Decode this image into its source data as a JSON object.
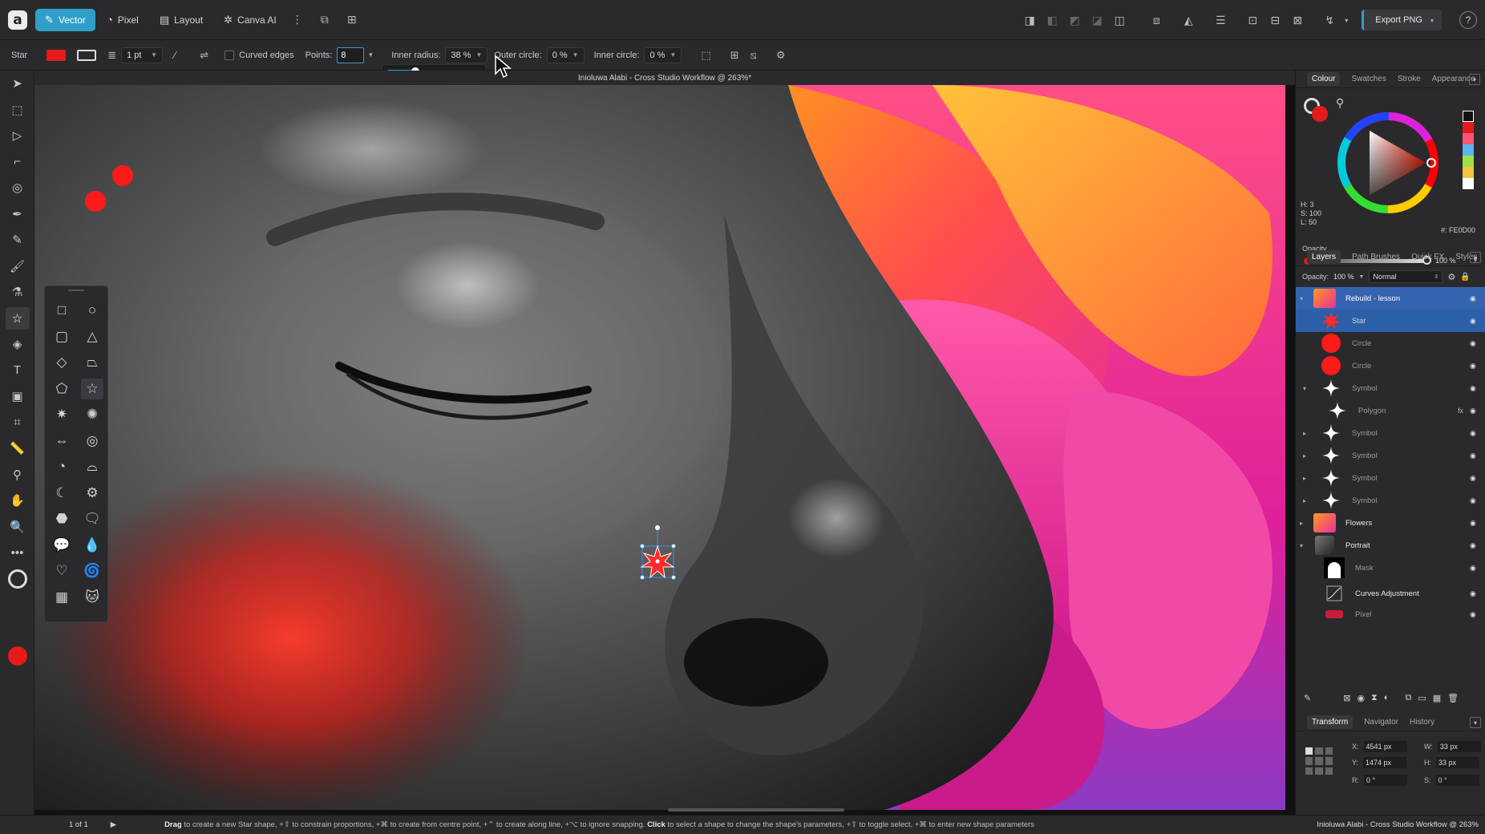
{
  "topbar": {
    "personas": [
      {
        "label": "Vector",
        "icon": "vector-icon"
      },
      {
        "label": "Pixel",
        "icon": "pixel-icon"
      },
      {
        "label": "Layout",
        "icon": "layout-icon"
      },
      {
        "label": "Canva AI",
        "icon": "sparkle-icon"
      }
    ],
    "export_label": "Export PNG"
  },
  "context_bar": {
    "tool_name": "Star",
    "stroke_width": "1 pt",
    "curved_edges_label": "Curved edges",
    "points_label": "Points:",
    "points_value": "8",
    "inner_radius_label": "Inner radius:",
    "inner_radius_value": "38 %",
    "outer_circle_label": "Outer circle:",
    "outer_circle_value": "0 %",
    "inner_circle_label": "Inner circle:",
    "inner_circle_value": "0 %",
    "slider_level": 0.38
  },
  "document": {
    "title": "Inioluwa Alabi - Cross Studio Workflow @ 263%*"
  },
  "colour_panel": {
    "tabs": [
      "Colour",
      "Swatches",
      "Stroke",
      "Appearance"
    ],
    "h": "H: 3",
    "s": "S: 100",
    "l": "L: 50",
    "hex": "#: FE0D00",
    "opacity_label": "Opacity",
    "opacity_value": "100 %",
    "accent": "#e31b1b"
  },
  "layers_panel": {
    "tabs": [
      "Layers",
      "Path Brushes",
      "Quick FX",
      "Styles"
    ],
    "opacity_label": "Opacity:",
    "opacity_value": "100 %",
    "blend_mode": "Normal",
    "layers": [
      {
        "name": "Rebuild - lesson",
        "thumb": "flowers-thumb",
        "selected": "top"
      },
      {
        "name": "Star",
        "thumb": "star-thumb",
        "selected": "yes"
      },
      {
        "name": "Circle",
        "thumb": "circle-thumb"
      },
      {
        "name": "Circle",
        "thumb": "circle-thumb"
      },
      {
        "name": "Symbol",
        "thumb": "sparkle-thumb"
      },
      {
        "name": "Polygon",
        "thumb": "sparkle-thumb",
        "fx": "fx"
      },
      {
        "name": "Symbol",
        "thumb": "sparkle-thumb"
      },
      {
        "name": "Symbol",
        "thumb": "sparkle-thumb"
      },
      {
        "name": "Symbol",
        "thumb": "sparkle-thumb"
      },
      {
        "name": "Symbol",
        "thumb": "sparkle-thumb"
      },
      {
        "name": "Flowers",
        "thumb": "flowers-thumb"
      },
      {
        "name": "Portrait",
        "thumb": "portrait-thumb"
      },
      {
        "name": "Mask",
        "thumb": "mask-thumb"
      },
      {
        "name": "Curves Adjustment",
        "thumb": "curves-thumb"
      },
      {
        "name": "Pixel",
        "thumb": "pixel-thumb"
      }
    ]
  },
  "transform_panel": {
    "tabs": [
      "Transform",
      "Navigator",
      "History"
    ],
    "x_label": "X:",
    "x_value": "4541 px",
    "y_label": "Y:",
    "y_value": "1474 px",
    "w_label": "W:",
    "w_value": "33 px",
    "h_label": "H:",
    "h_value": "33 px",
    "r_label": "R:",
    "r_value": "0 °",
    "s_label": "S:",
    "s_value": "0 °"
  },
  "statusbar": {
    "page": "1 of 1",
    "hint_drag": "Drag",
    "hint_part1": " to create a new Star shape, +⇧ to constrain proportions, +⌘ to create from centre point, +⌃ to create along line, +⌥ to ignore snapping. ",
    "hint_click": "Click",
    "hint_part2": " to select a shape to change the shape's parameters, +⇧ to toggle select, +⌘ to enter new shape parameters",
    "doc": "Inioluwa Alabi - Cross Studio Workflow @ 263%"
  }
}
